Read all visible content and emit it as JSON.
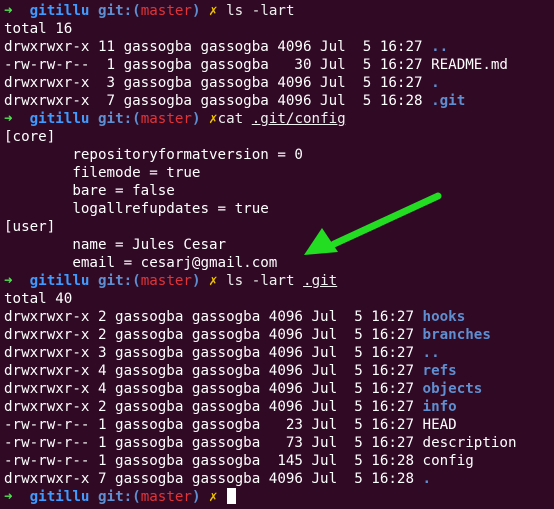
{
  "prompt": {
    "arrow": "➜",
    "dir": "gitillu",
    "git_prefix": "git:(",
    "branch": "master",
    "git_suffix": ")",
    "dirty_mark": "✗"
  },
  "colors": {
    "background": "#300a24",
    "arrow": "#4ee44e",
    "directory": "#3f9bff",
    "git_label": "#5f8fd0",
    "branch": "#e0333a",
    "dirty_mark": "#f0c300",
    "text": "#ffffff",
    "listing_dir": "#5f8fd0",
    "cursor": "#ffffff",
    "annotation_arrow": "#22dd22"
  },
  "commands": [
    {
      "cmd": "ls",
      "args": "-lart",
      "underlined_arg": ""
    },
    {
      "cmd": "cat",
      "args": " ",
      "underlined_arg": ".git/config"
    },
    {
      "cmd": "ls",
      "args": "-lart ",
      "underlined_arg": ".git"
    }
  ],
  "output1": {
    "total": "total 16",
    "rows": [
      {
        "perms": "drwxrwxr-x 11 gassogba gassogba 4096 Jul  5 16:27 ",
        "name": "..",
        "kind": "dir"
      },
      {
        "perms": "-rw-rw-r--  1 gassogba gassogba   30 Jul  5 16:27 ",
        "name": "README.md",
        "kind": "file"
      },
      {
        "perms": "drwxrwxr-x  3 gassogba gassogba 4096 Jul  5 16:27 ",
        "name": ".",
        "kind": "dir"
      },
      {
        "perms": "drwxrwxr-x  7 gassogba gassogba 4096 Jul  5 16:28 ",
        "name": ".git",
        "kind": "dir"
      }
    ]
  },
  "config": [
    "[core]",
    "\trepositoryformatversion = 0",
    "\tfilemode = true",
    "\tbare = false",
    "\tlogallrefupdates = true",
    "[user]",
    "\tname = Jules Cesar",
    "\temail = cesarj@gmail.com"
  ],
  "output2": {
    "total": "total 40",
    "rows": [
      {
        "perms": "drwxrwxr-x 2 gassogba gassogba 4096 Jul  5 16:27 ",
        "name": "hooks",
        "kind": "dir"
      },
      {
        "perms": "drwxrwxr-x 2 gassogba gassogba 4096 Jul  5 16:27 ",
        "name": "branches",
        "kind": "dir"
      },
      {
        "perms": "drwxrwxr-x 3 gassogba gassogba 4096 Jul  5 16:27 ",
        "name": "..",
        "kind": "dir"
      },
      {
        "perms": "drwxrwxr-x 4 gassogba gassogba 4096 Jul  5 16:27 ",
        "name": "refs",
        "kind": "dir"
      },
      {
        "perms": "drwxrwxr-x 4 gassogba gassogba 4096 Jul  5 16:27 ",
        "name": "objects",
        "kind": "dir"
      },
      {
        "perms": "drwxrwxr-x 2 gassogba gassogba 4096 Jul  5 16:27 ",
        "name": "info",
        "kind": "dir"
      },
      {
        "perms": "-rw-rw-r-- 1 gassogba gassogba   23 Jul  5 16:27 ",
        "name": "HEAD",
        "kind": "file"
      },
      {
        "perms": "-rw-rw-r-- 1 gassogba gassogba   73 Jul  5 16:27 ",
        "name": "description",
        "kind": "file"
      },
      {
        "perms": "-rw-rw-r-- 1 gassogba gassogba  145 Jul  5 16:28 ",
        "name": "config",
        "kind": "file"
      },
      {
        "perms": "drwxrwxr-x 7 gassogba gassogba 4096 Jul  5 16:28 ",
        "name": ".",
        "kind": "dir"
      }
    ]
  },
  "annotation": {
    "icon": "green-arrow-icon",
    "points_to": "email = cesarj@gmail.com"
  }
}
